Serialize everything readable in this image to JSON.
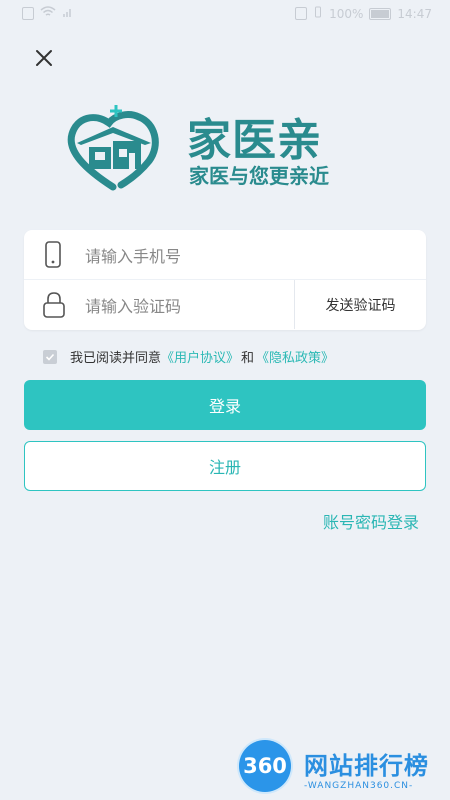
{
  "status_bar": {
    "battery": "100%",
    "time": "14:47"
  },
  "brand": {
    "name": "家医亲",
    "slogan": "家医与您更亲近",
    "color": "#2a8b8e"
  },
  "form": {
    "phone_placeholder": "请输入手机号",
    "code_placeholder": "请输入验证码",
    "send_code_label": "发送验证码"
  },
  "agreement": {
    "prefix": "我已阅读并同意",
    "user_agreement": "《用户协议》",
    "and": "和",
    "privacy_policy": "《隐私政策》",
    "checked": true
  },
  "buttons": {
    "login": "登录",
    "register": "注册",
    "password_login": "账号密码登录"
  },
  "watermark": {
    "badge": "360",
    "title": "网站排行榜",
    "subtitle": "-WANGZHAN360.CN-"
  },
  "colors": {
    "accent": "#2ec4c1",
    "background": "#edf1f6"
  }
}
